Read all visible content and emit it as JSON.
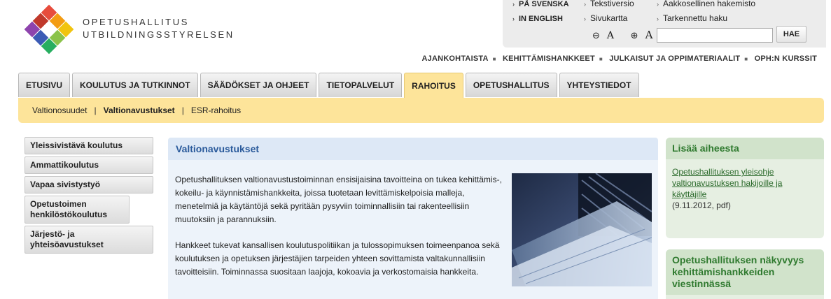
{
  "brand": {
    "line1": "OPETUSHALLITUS",
    "line2": "UTBILDNINGSSTYRELSEN"
  },
  "utility": {
    "svenska": "PÅ SVENSKA",
    "english": "IN ENGLISH",
    "tekstiversio": "Tekstiversio",
    "sivukartta": "Sivukartta",
    "hakemisto": "Aakkosellinen hakemisto",
    "tarkennettu": "Tarkennettu haku",
    "zoom_out_label": "A",
    "zoom_in_label": "A",
    "search_value": "",
    "search_button": "HAE"
  },
  "secondary_nav": [
    "AJANKOHTAISTA",
    "KEHITTÄMISHANKKEET",
    "JULKAISUT JA OPPIMATERIAALIT",
    "OPH:N KURSSIT"
  ],
  "tabs": [
    "ETUSIVU",
    "KOULUTUS JA TUTKINNOT",
    "SÄÄDÖKSET JA OHJEET",
    "TIETOPALVELUT",
    "RAHOITUS",
    "OPETUSHALLITUS",
    "YHTEYSTIEDOT"
  ],
  "active_tab": "RAHOITUS",
  "subnav": {
    "items": [
      "Valtionosuudet",
      "Valtionavustukset",
      "ESR-rahoitus"
    ],
    "active": "Valtionavustukset"
  },
  "sidebar": {
    "items": [
      "Yleissivistävä koulutus",
      "Ammattikoulutus",
      "Vapaa sivistystyö",
      "Opetustoimen henkilöstökoulutus",
      "Järjestö- ja yhteisöavustukset"
    ]
  },
  "content": {
    "title": "Valtionavustukset",
    "paragraph1": "Opetushallituksen valtionavustustoiminnan ensisijaisina tavoitteina on tukea kehittämis-, kokeilu- ja käynnistämishankkeita, joissa tuotetaan levittämiskelpoisia malleja, menetelmiä ja käytäntöjä sekä pyritään pysyviin toiminnallisiin tai rakenteellisiin muutoksiin ja parannuksiin.",
    "paragraph2": "Hankkeet tukevat kansallisen koulutuspolitiikan ja tulossopimuksen toimeenpanoa sekä koulutuksen ja opetuksen järjestäjien tarpeiden yhteen sovittamista valtakunnallisiin tavoitteisiin. Toiminnassa suositaan laajoja, kokoavia ja verkostomaisia hankkeita."
  },
  "right": {
    "box1_title": "Lisää aiheesta",
    "box1_link": "Opetushallituksen yleisohje valtionavustuksen hakijoille ja käyttäjille",
    "box1_meta": "(9.11.2012, pdf)",
    "box2_title": "Opetushallituksen näkyvyys kehittämishankkeiden viestinnässä"
  },
  "colors": {
    "tab_active": "#fde49a",
    "content_title": "#2a5a9b",
    "right_title": "#2f7a2f"
  }
}
